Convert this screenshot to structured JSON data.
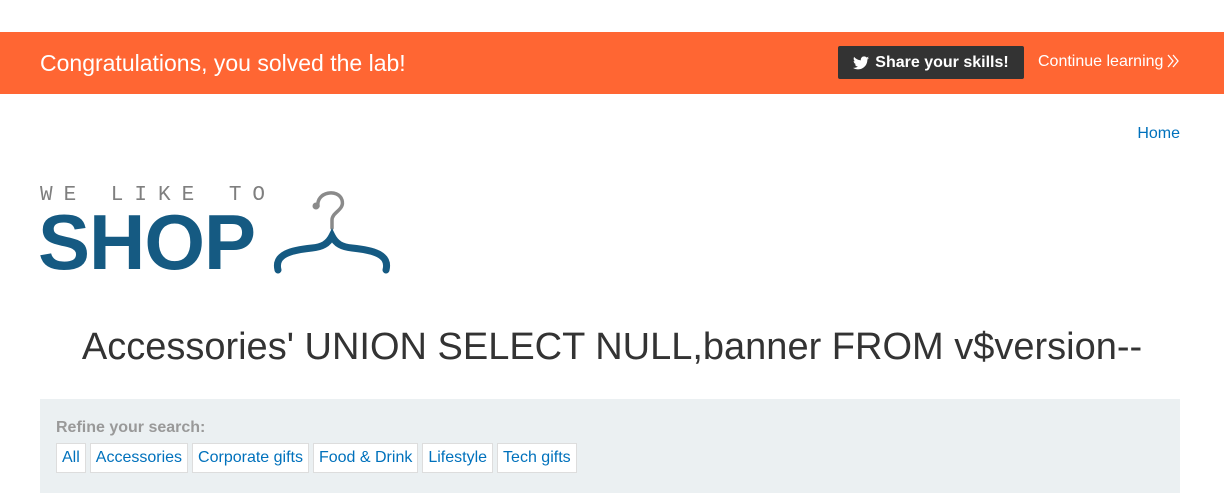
{
  "banner": {
    "message": "Congratulations, you solved the lab!",
    "share_label": "Share your skills!",
    "continue_label": "Continue learning",
    "color": "#ff6633"
  },
  "nav": {
    "home_label": "Home"
  },
  "logo": {
    "tagline": "WE LIKE TO",
    "word": "SHOP",
    "icon": "hanger-icon"
  },
  "page": {
    "title": "Accessories' UNION SELECT NULL,banner FROM v$version--"
  },
  "filter": {
    "label": "Refine your search:",
    "categories": [
      "All",
      "Accessories",
      "Corporate gifts",
      "Food & Drink",
      "Lifestyle",
      "Tech gifts"
    ]
  },
  "colors": {
    "link": "#0071bc",
    "logo_blue": "#155a82",
    "panel_bg": "#ebf0f2"
  }
}
